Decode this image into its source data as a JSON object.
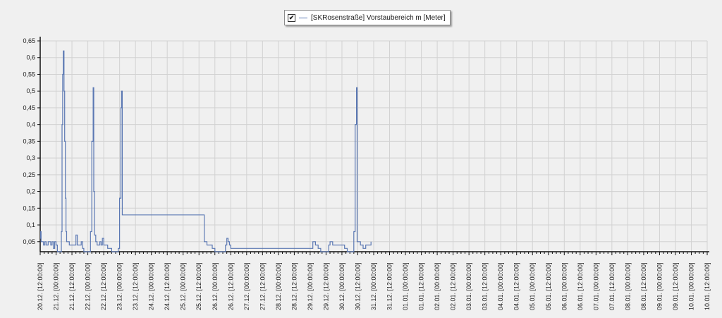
{
  "legend": {
    "checked_glyph": "✔",
    "series_label": "[SKRosenstraße] Vorstaubereich m [Meter]"
  },
  "colors": {
    "line": "#5b78b3",
    "grid": "#d2d2d2",
    "axis": "#111111",
    "background": "#f0f0f0"
  },
  "chart_data": {
    "type": "line",
    "ylim": [
      0.02,
      0.65
    ],
    "yticks": [
      {
        "value": 0.05,
        "label": "0,05"
      },
      {
        "value": 0.1,
        "label": "0,1"
      },
      {
        "value": 0.15,
        "label": "0,15"
      },
      {
        "value": 0.2,
        "label": "0,2"
      },
      {
        "value": 0.25,
        "label": "0,25"
      },
      {
        "value": 0.3,
        "label": "0,3"
      },
      {
        "value": 0.35,
        "label": "0,35"
      },
      {
        "value": 0.4,
        "label": "0,4"
      },
      {
        "value": 0.45,
        "label": "0,45"
      },
      {
        "value": 0.5,
        "label": "0,5"
      },
      {
        "value": 0.55,
        "label": "0,55"
      },
      {
        "value": 0.6,
        "label": "0,6"
      },
      {
        "value": 0.65,
        "label": "0,65"
      }
    ],
    "xlim": [
      "2012-12-20T12:00",
      "2013-01-10T12:00"
    ],
    "xticks": [
      "20.12. [12:00:00]",
      "21.12. [00:00:00]",
      "21.12. [12:00:00]",
      "22.12. [00:00:00]",
      "22.12. [12:00:00]",
      "23.12. [00:00:00]",
      "23.12. [12:00:00]",
      "24.12. [00:00:00]",
      "24.12. [12:00:00]",
      "25.12. [00:00:00]",
      "25.12. [12:00:00]",
      "26.12. [00:00:00]",
      "26.12. [12:00:00]",
      "27.12. [00:00:00]",
      "27.12. [12:00:00]",
      "28.12. [00:00:00]",
      "28.12. [12:00:00]",
      "29.12. [00:00:00]",
      "29.12. [12:00:00]",
      "30.12. [00:00:00]",
      "30.12. [12:00:00]",
      "31.12. [00:00:00]",
      "31.12. [12:00:00]",
      "01.01. [00:00:00]",
      "01.01. [12:00:00]",
      "02.01. [00:00:00]",
      "02.01. [12:00:00]",
      "03.01. [00:00:00]",
      "03.01. [12:00:00]",
      "04.01. [00:00:00]",
      "04.01. [12:00:00]",
      "05.01. [00:00:00]",
      "05.01. [12:00:00]",
      "06.01. [00:00:00]",
      "06.01. [12:00:00]",
      "07.01. [00:00:00]",
      "07.01. [12:00:00]",
      "08.01. [00:00:00]",
      "08.01. [12:00:00]",
      "09.01. [00:00:00]",
      "09.01. [12:00:00]",
      "10.01. [00:00:00]",
      "10.01. [12:00:00]"
    ],
    "grid": true,
    "legend_position": "top-center",
    "series": [
      {
        "name": "[SKRosenstraße] Vorstaubereich m [Meter]",
        "points": [
          [
            "2012-12-20T12:00",
            0.06
          ],
          [
            "2012-12-20T12:20",
            0.08
          ],
          [
            "2012-12-20T12:40",
            0.05
          ],
          [
            "2012-12-20T14:00",
            0.05
          ],
          [
            "2012-12-20T14:30",
            0.04
          ],
          [
            "2012-12-20T15:30",
            0.05
          ],
          [
            "2012-12-20T16:30",
            0.04
          ],
          [
            "2012-12-20T17:30",
            0.04
          ],
          [
            "2012-12-20T18:00",
            0.05
          ],
          [
            "2012-12-20T19:30",
            0.05
          ],
          [
            "2012-12-20T20:00",
            0.04
          ],
          [
            "2012-12-20T21:00",
            0.05
          ],
          [
            "2012-12-20T22:00",
            0.03
          ],
          [
            "2012-12-20T23:00",
            0.05
          ],
          [
            "2012-12-21T00:00",
            0.04
          ],
          [
            "2012-12-21T01:00",
            0.02
          ],
          [
            "2012-12-21T03:00",
            0.02
          ],
          [
            "2012-12-21T04:00",
            0.08
          ],
          [
            "2012-12-21T04:30",
            0.4
          ],
          [
            "2012-12-21T05:00",
            0.55
          ],
          [
            "2012-12-21T05:30",
            0.62
          ],
          [
            "2012-12-21T06:00",
            0.5
          ],
          [
            "2012-12-21T06:30",
            0.35
          ],
          [
            "2012-12-21T07:00",
            0.18
          ],
          [
            "2012-12-21T07:30",
            0.08
          ],
          [
            "2012-12-21T08:00",
            0.05
          ],
          [
            "2012-12-21T10:00",
            0.04
          ],
          [
            "2012-12-21T14:00",
            0.04
          ],
          [
            "2012-12-21T15:00",
            0.07
          ],
          [
            "2012-12-21T16:00",
            0.04
          ],
          [
            "2012-12-21T19:00",
            0.05
          ],
          [
            "2012-12-21T20:00",
            0.03
          ],
          [
            "2012-12-21T21:00",
            0.02
          ],
          [
            "2012-12-22T01:00",
            0.02
          ],
          [
            "2012-12-22T02:00",
            0.08
          ],
          [
            "2012-12-22T03:00",
            0.35
          ],
          [
            "2012-12-22T04:00",
            0.51
          ],
          [
            "2012-12-22T04:30",
            0.2
          ],
          [
            "2012-12-22T05:00",
            0.07
          ],
          [
            "2012-12-22T06:00",
            0.05
          ],
          [
            "2012-12-22T07:00",
            0.04
          ],
          [
            "2012-12-22T09:00",
            0.05
          ],
          [
            "2012-12-22T10:00",
            0.04
          ],
          [
            "2012-12-22T11:00",
            0.06
          ],
          [
            "2012-12-22T12:00",
            0.04
          ],
          [
            "2012-12-22T14:00",
            0.04
          ],
          [
            "2012-12-22T15:00",
            0.03
          ],
          [
            "2012-12-22T17:00",
            0.03
          ],
          [
            "2012-12-22T18:00",
            0.02
          ],
          [
            "2012-12-22T22:00",
            0.02
          ],
          [
            "2012-12-22T23:00",
            0.03
          ],
          [
            "2012-12-23T00:00",
            0.18
          ],
          [
            "2012-12-23T01:00",
            0.45
          ],
          [
            "2012-12-23T01:30",
            0.5
          ],
          [
            "2012-12-23T02:00",
            0.13
          ],
          [
            "2012-12-25T15:00",
            0.13
          ],
          [
            "2012-12-25T16:00",
            0.05
          ],
          [
            "2012-12-25T18:00",
            0.04
          ],
          [
            "2012-12-25T20:00",
            0.04
          ],
          [
            "2012-12-25T22:00",
            0.03
          ],
          [
            "2012-12-26T00:00",
            0.02
          ],
          [
            "2012-12-26T06:00",
            0.02
          ],
          [
            "2012-12-26T08:00",
            0.04
          ],
          [
            "2012-12-26T09:00",
            0.06
          ],
          [
            "2012-12-26T10:00",
            0.05
          ],
          [
            "2012-12-26T11:00",
            0.04
          ],
          [
            "2012-12-26T12:00",
            0.03
          ],
          [
            "2012-12-29T00:00",
            0.03
          ],
          [
            "2012-12-29T02:00",
            0.05
          ],
          [
            "2012-12-29T04:00",
            0.04
          ],
          [
            "2012-12-29T06:00",
            0.03
          ],
          [
            "2012-12-29T08:00",
            0.02
          ],
          [
            "2012-12-29T12:00",
            0.02
          ],
          [
            "2012-12-29T14:00",
            0.04
          ],
          [
            "2012-12-29T15:00",
            0.05
          ],
          [
            "2012-12-29T17:00",
            0.04
          ],
          [
            "2012-12-30T00:00",
            0.04
          ],
          [
            "2012-12-30T02:00",
            0.03
          ],
          [
            "2012-12-30T04:00",
            0.02
          ],
          [
            "2012-12-30T08:00",
            0.02
          ],
          [
            "2012-12-30T09:00",
            0.08
          ],
          [
            "2012-12-30T10:00",
            0.4
          ],
          [
            "2012-12-30T11:00",
            0.51
          ],
          [
            "2012-12-30T11:30",
            0.05
          ],
          [
            "2012-12-30T14:00",
            0.04
          ],
          [
            "2012-12-30T16:00",
            0.03
          ],
          [
            "2012-12-30T18:00",
            0.04
          ],
          [
            "2012-12-30T21:00",
            0.04
          ],
          [
            "2012-12-30T22:00",
            0.05
          ]
        ]
      }
    ]
  }
}
